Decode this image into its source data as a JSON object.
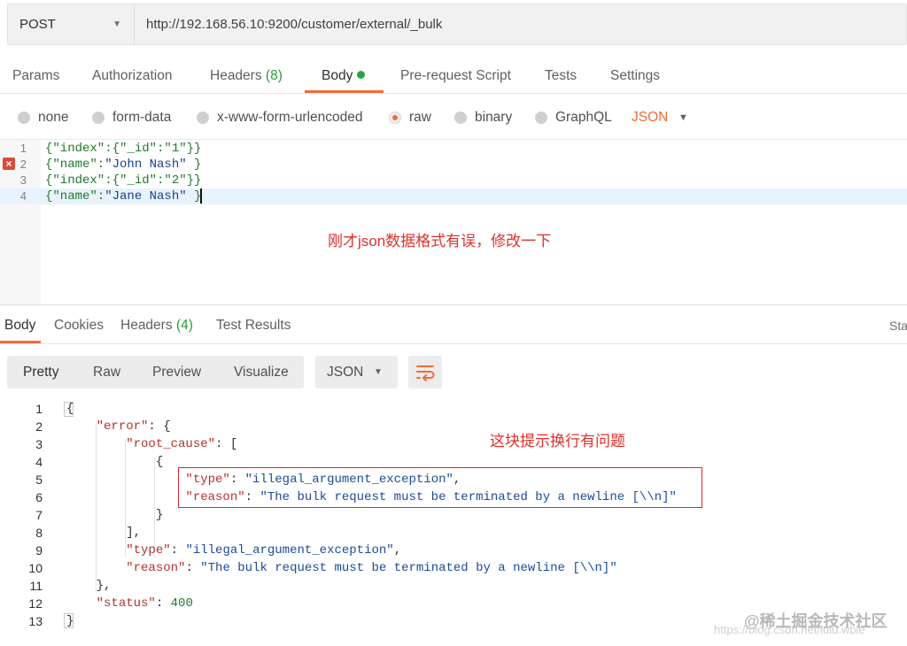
{
  "request": {
    "method": "POST",
    "url": "http://192.168.56.10:9200/customer/external/_bulk"
  },
  "request_tabs": [
    {
      "label": "Params"
    },
    {
      "label": "Authorization"
    },
    {
      "label": "Headers",
      "count": "(8)"
    },
    {
      "label": "Body"
    },
    {
      "label": "Pre-request Script"
    },
    {
      "label": "Tests"
    },
    {
      "label": "Settings"
    }
  ],
  "body_types": {
    "options": [
      "none",
      "form-data",
      "x-www-form-urlencoded",
      "raw",
      "binary",
      "GraphQL"
    ],
    "selected": "raw",
    "format": "JSON"
  },
  "editor": {
    "lines": [
      {
        "num": "1",
        "text": "{\"index\":{\"_id\":\"1\"}}"
      },
      {
        "num": "2",
        "text": "{\"name\":\"John Nash\" }"
      },
      {
        "num": "3",
        "text": "{\"index\":{\"_id\":\"2\"}}"
      },
      {
        "num": "4",
        "text": "{\"name\":\"Jane Nash\" }"
      }
    ],
    "error_line": "2",
    "annotation": "刚才json数据格式有误，修改一下"
  },
  "response_tabs": [
    {
      "label": "Body"
    },
    {
      "label": "Cookies"
    },
    {
      "label": "Headers",
      "count": "(4)"
    },
    {
      "label": "Test Results"
    }
  ],
  "status_label": "Sta",
  "response_toolbar": {
    "views": [
      "Pretty",
      "Raw",
      "Preview",
      "Visualize"
    ],
    "format": "JSON"
  },
  "response": {
    "line_numbers": [
      "1",
      "2",
      "3",
      "4",
      "5",
      "6",
      "7",
      "8",
      "9",
      "10",
      "11",
      "12",
      "13"
    ],
    "error_key": "\"error\"",
    "root_cause_key": "\"root_cause\"",
    "type_key": "\"type\"",
    "reason_key": "\"reason\"",
    "status_key": "\"status\"",
    "type_value": "\"illegal_argument_exception\"",
    "reason_value": "\"The bulk request must be terminated by a newline [\\\\n]\"",
    "status_value": "400",
    "annotation": "这块提示换行有问题"
  },
  "watermark": "@稀土掘金技术社区",
  "watermark_url": "https://blog.csdn.net/lulu.wble"
}
